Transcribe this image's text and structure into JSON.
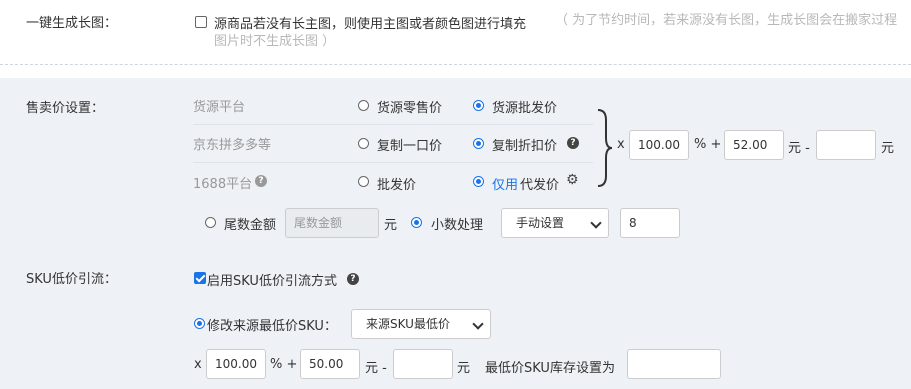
{
  "long_image": {
    "label": "一键生成长图：",
    "checkbox_label": "源商品若没有长主图，则使用主图或者颜色图进行填充",
    "hint_line1": "（ 为了节约时间，若来源没有长图，生成长图会在搬家过程",
    "hint_line2": "图片时不生成长图 ）",
    "checked": false
  },
  "price": {
    "label": "售卖价设置：",
    "rows": [
      {
        "platform": "货源平台",
        "option_a": "货源零售价",
        "option_b": "货源批发价",
        "selected": "b"
      },
      {
        "platform": "京东拼多多等",
        "option_a": "复制一口价",
        "option_b": "复制折扣价",
        "selected": "b"
      },
      {
        "platform": "1688平台",
        "option_a": "批发价",
        "option_b_prefix": "仅用",
        "option_b": "代发价",
        "selected": "b"
      }
    ],
    "formula": {
      "x_label": "x",
      "multiplier": "100.00",
      "percent_plus": "% +",
      "addend": "52.00",
      "yuan_minus": "元 -",
      "subtract": "",
      "yuan": "元"
    },
    "tail": {
      "tail_label": "尾数金额",
      "tail_placeholder": "尾数金额",
      "yuan": "元",
      "decimal_label": "小数处理",
      "decimal_mode": "手动设置",
      "decimal_value": "8",
      "selected": "decimal"
    }
  },
  "sku": {
    "label": "SKU低价引流：",
    "enable_label": "启用SKU低价引流方式",
    "enabled": true,
    "modify_label": "修改来源最低价SKU：",
    "modify_select": "来源SKU最低价",
    "formula": {
      "x_label": "x",
      "multiplier": "100.00",
      "percent_plus": "% +",
      "addend": "50.00",
      "yuan_minus": "元 -",
      "subtract": "",
      "yuan": "元",
      "stock_label": "最低价SKU库存设置为",
      "stock_value": ""
    }
  },
  "icons": {
    "question": "question-circle-icon",
    "gear": "gear-icon"
  },
  "colors": {
    "accent": "#1a73e8",
    "band": "#eef2f6"
  }
}
